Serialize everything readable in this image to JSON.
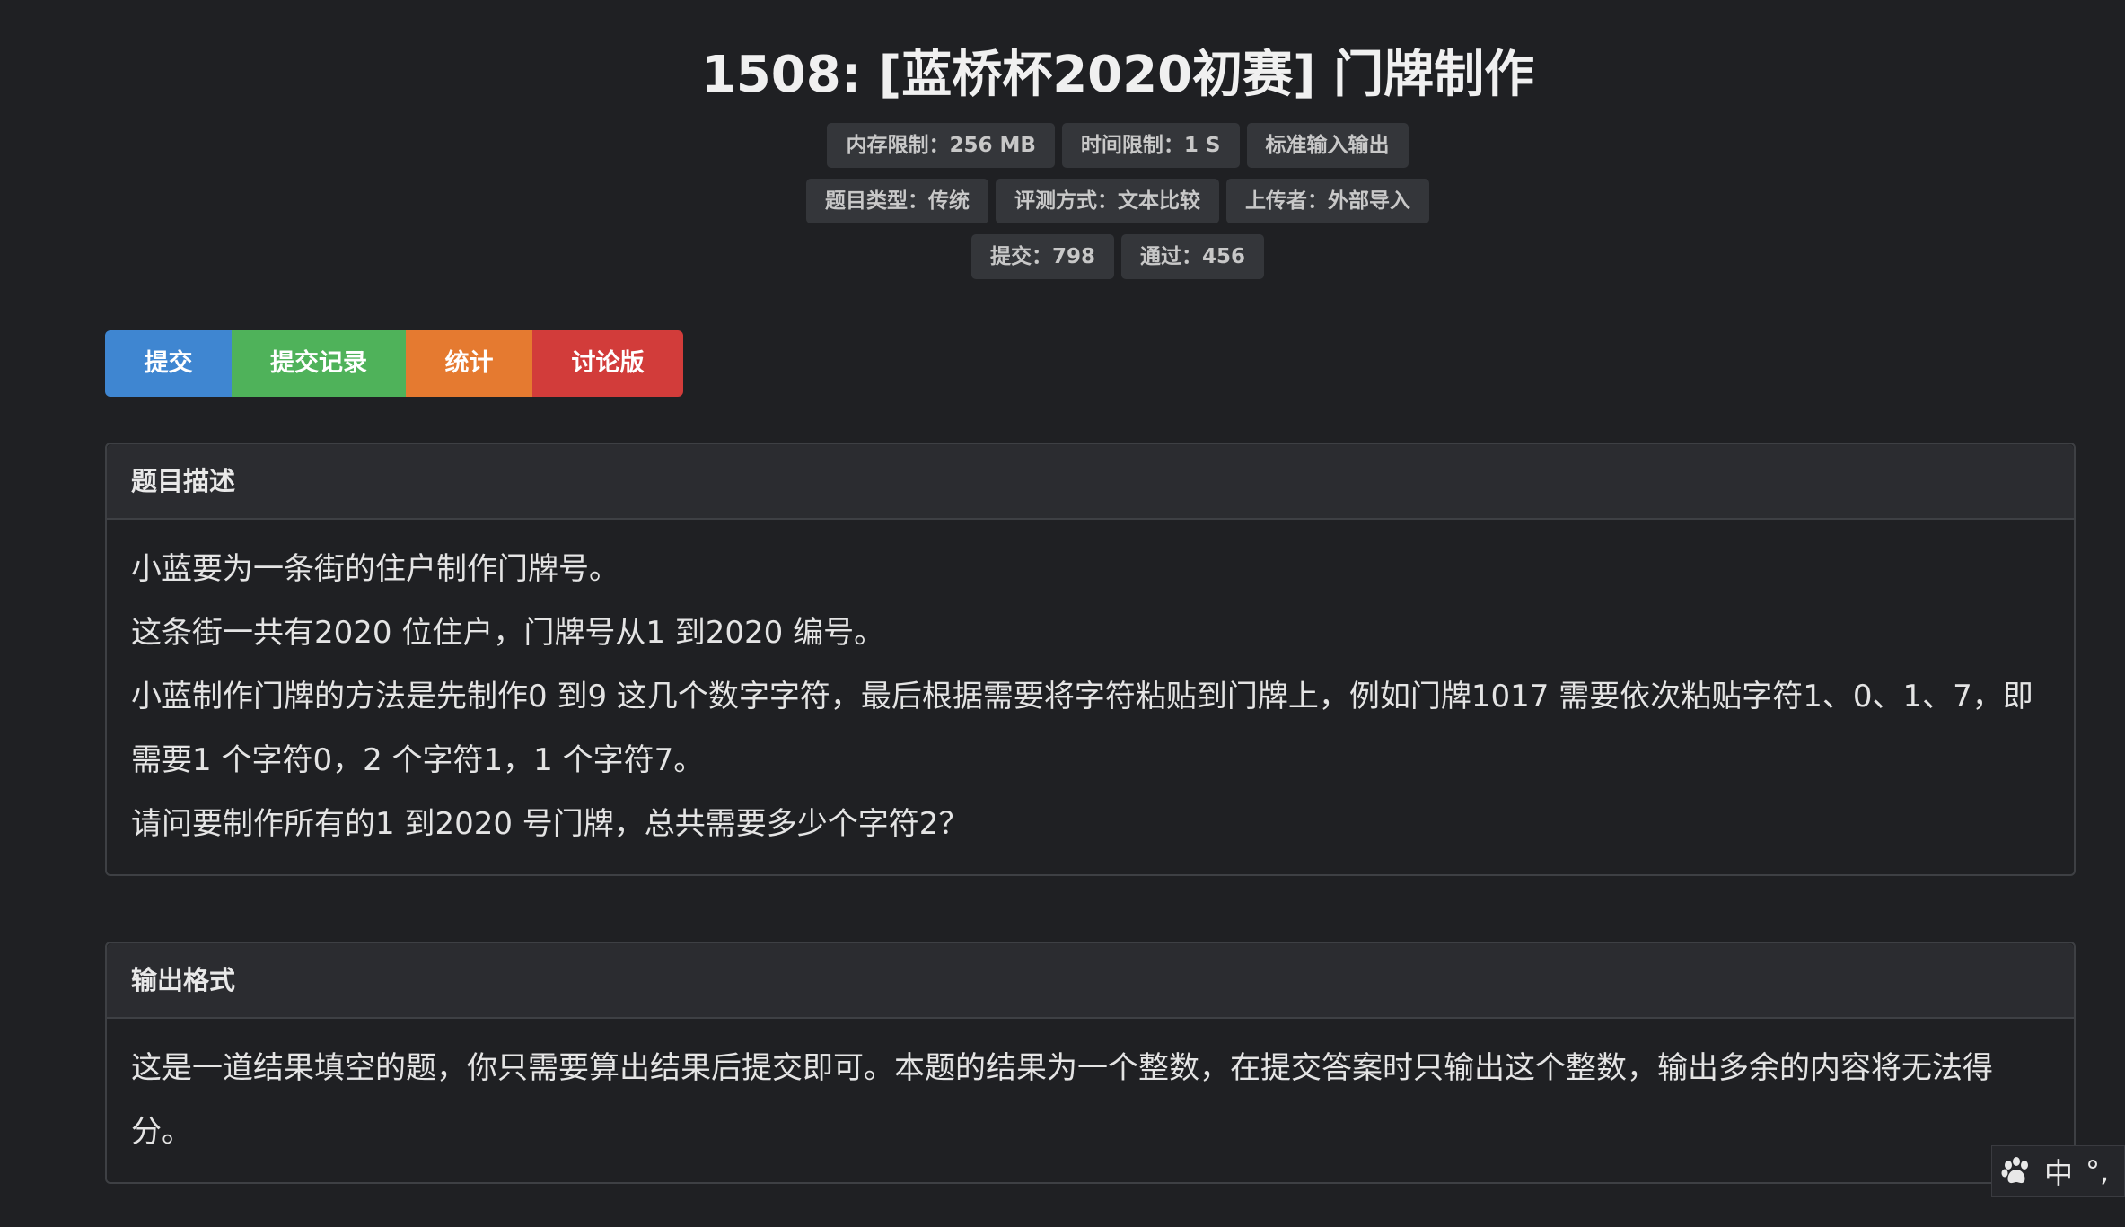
{
  "problem": {
    "title": "1508: [蓝桥杯2020初赛] 门牌制作",
    "badges_row1": [
      "内存限制：256 MB",
      "时间限制：1 S",
      "标准输入输出"
    ],
    "badges_row2": [
      "题目类型：传统",
      "评测方式：文本比较",
      "上传者：外部导入"
    ],
    "badges_row3": [
      "提交：798",
      "通过：456"
    ]
  },
  "actions": {
    "submit": "提交",
    "records": "提交记录",
    "stats": "统计",
    "discuss": "讨论版"
  },
  "description": {
    "heading": "题目描述",
    "lines": [
      "小蓝要为一条街的住户制作门牌号。",
      "这条街一共有2020 位住户，门牌号从1 到2020 编号。",
      "小蓝制作门牌的方法是先制作0 到9 这几个数字字符，最后根据需要将字符粘贴到门牌上，例如门牌1017 需要依次粘贴字符1、0、1、7，即需要1 个字符0，2 个字符1，1 个字符7。",
      "请问要制作所有的1 到2020 号门牌，总共需要多少个字符2？"
    ]
  },
  "output_format": {
    "heading": "输出格式",
    "text": "这是一道结果填空的题，你只需要算出结果后提交即可。本题的结果为一个整数，在提交答案时只输出这个整数，输出多余的内容将无法得分。"
  },
  "ime": {
    "icon": "paw-icon",
    "mode": "中",
    "punct": "°,"
  }
}
